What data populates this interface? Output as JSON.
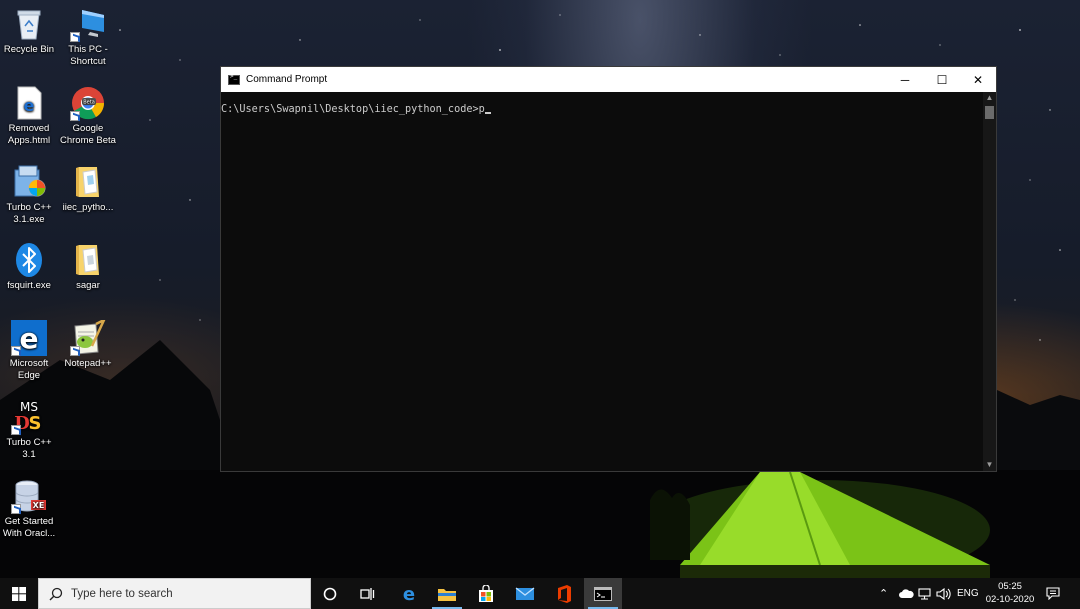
{
  "desktop": {
    "icons": [
      {
        "label": "Recycle Bin",
        "icon": "recycle-bin-icon"
      },
      {
        "label": "This PC - Shortcut",
        "icon": "this-pc-icon"
      },
      {
        "label": "Removed Apps.html",
        "icon": "edge-document-icon"
      },
      {
        "label": "Google Chrome Beta",
        "icon": "chrome-beta-icon",
        "badge": "Beta"
      },
      {
        "label": "Turbo C++ 3.1.exe",
        "icon": "turbo-cpp-installer-icon"
      },
      {
        "label": "iiec_pytho...",
        "icon": "folder-icon"
      },
      {
        "label": "fsquirt.exe",
        "icon": "bluetooth-icon"
      },
      {
        "label": "sagar",
        "icon": "folder-icon"
      },
      {
        "label": "Microsoft Edge",
        "icon": "edge-icon"
      },
      {
        "label": "Notepad++",
        "icon": "notepad-plus-plus-icon"
      },
      {
        "label": "Turbo C++ 3.1",
        "icon": "turbo-cpp-icon",
        "badge_text": "MS"
      },
      {
        "label": "Get Started With Oracl...",
        "icon": "oracle-database-icon",
        "badge_text": "XE"
      }
    ]
  },
  "cmd_window": {
    "title": "Command Prompt",
    "prompt": "C:\\Users\\Swapnil\\Desktop\\iiec_python_code>",
    "typed": "p",
    "controls": {
      "minimize": "─",
      "maximize": "☐",
      "close": "✕"
    }
  },
  "taskbar": {
    "search_placeholder": "Type here to search",
    "apps": [
      {
        "name": "cortana",
        "icon": "cortana-circle-icon"
      },
      {
        "name": "task-view",
        "icon": "task-view-icon"
      },
      {
        "name": "edge",
        "icon": "edge-icon"
      },
      {
        "name": "file-explorer",
        "icon": "file-explorer-icon"
      },
      {
        "name": "store",
        "icon": "store-icon"
      },
      {
        "name": "mail",
        "icon": "mail-icon"
      },
      {
        "name": "office",
        "icon": "office-icon"
      },
      {
        "name": "command-prompt",
        "icon": "cmd-icon",
        "active": true
      }
    ],
    "tray": {
      "language": "ENG",
      "time": "05:25",
      "date": "02-10-2020"
    }
  },
  "colors": {
    "accent": "#76b9ed",
    "console_bg": "#0c0c0c",
    "console_text": "#cccccc",
    "taskbar_bg": "#101010"
  }
}
